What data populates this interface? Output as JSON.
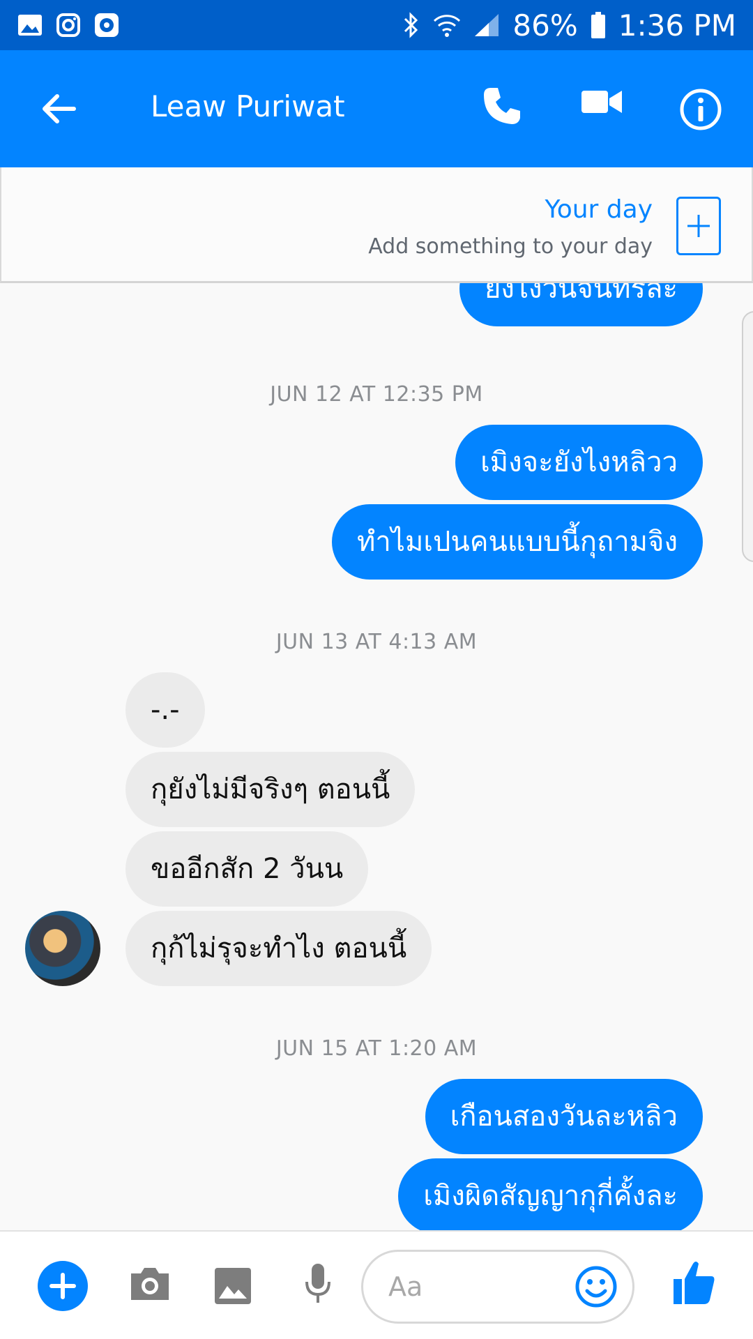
{
  "status_bar": {
    "battery": "86%",
    "time": "1:36 PM"
  },
  "header": {
    "contact_name": "Leaw Puriwat"
  },
  "your_day": {
    "title": "Your day",
    "subtitle": "Add something to your day"
  },
  "messages": [
    {
      "type": "out",
      "text": "ยังไงวันจันทร์ละ"
    },
    {
      "type": "timestamp",
      "text": "JUN 12 AT 12:35 PM"
    },
    {
      "type": "out",
      "text": "เมิงจะยังไงหลิวว"
    },
    {
      "type": "out",
      "text": "ทำไมเปนคนแบบนี้กุถามจิง"
    },
    {
      "type": "timestamp",
      "text": "JUN 13 AT 4:13 AM"
    },
    {
      "type": "in",
      "text": "-.-"
    },
    {
      "type": "in",
      "text": "กุยังไม่มีจริงๆ ตอนนี้"
    },
    {
      "type": "in",
      "text": "ขออีกสัก 2 วันน"
    },
    {
      "type": "in",
      "text": "กุก้ไม่รุจะทำไง ตอนนี้"
    },
    {
      "type": "timestamp",
      "text": "JUN 15 AT 1:20 AM"
    },
    {
      "type": "out",
      "text": "เกือนสองวันละหลิว"
    },
    {
      "type": "out",
      "text": "เมิงผิดสัญญากุกี่คั้งละ"
    }
  ],
  "composer": {
    "placeholder": "Aa"
  },
  "colors": {
    "status_bar": "#005fc9",
    "header": "#0384ff",
    "outgoing_bubble": "#0384ff",
    "incoming_bubble": "#ebebeb"
  }
}
